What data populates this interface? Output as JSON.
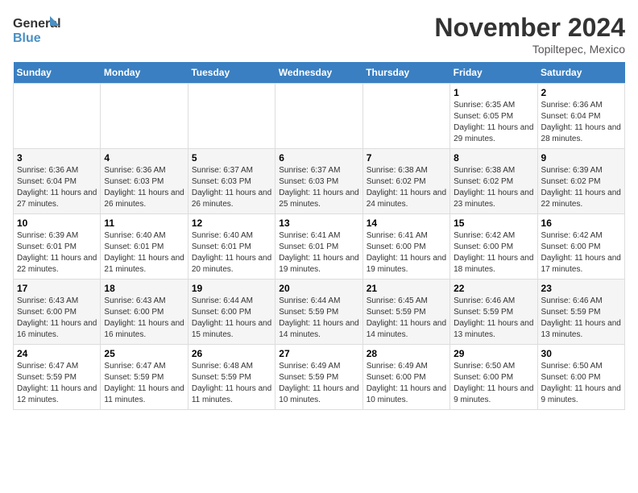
{
  "header": {
    "logo_line1": "General",
    "logo_line2": "Blue",
    "month": "November 2024",
    "location": "Topiltepec, Mexico"
  },
  "weekdays": [
    "Sunday",
    "Monday",
    "Tuesday",
    "Wednesday",
    "Thursday",
    "Friday",
    "Saturday"
  ],
  "weeks": [
    [
      {
        "day": "",
        "info": ""
      },
      {
        "day": "",
        "info": ""
      },
      {
        "day": "",
        "info": ""
      },
      {
        "day": "",
        "info": ""
      },
      {
        "day": "",
        "info": ""
      },
      {
        "day": "1",
        "info": "Sunrise: 6:35 AM\nSunset: 6:05 PM\nDaylight: 11 hours and 29 minutes."
      },
      {
        "day": "2",
        "info": "Sunrise: 6:36 AM\nSunset: 6:04 PM\nDaylight: 11 hours and 28 minutes."
      }
    ],
    [
      {
        "day": "3",
        "info": "Sunrise: 6:36 AM\nSunset: 6:04 PM\nDaylight: 11 hours and 27 minutes."
      },
      {
        "day": "4",
        "info": "Sunrise: 6:36 AM\nSunset: 6:03 PM\nDaylight: 11 hours and 26 minutes."
      },
      {
        "day": "5",
        "info": "Sunrise: 6:37 AM\nSunset: 6:03 PM\nDaylight: 11 hours and 26 minutes."
      },
      {
        "day": "6",
        "info": "Sunrise: 6:37 AM\nSunset: 6:03 PM\nDaylight: 11 hours and 25 minutes."
      },
      {
        "day": "7",
        "info": "Sunrise: 6:38 AM\nSunset: 6:02 PM\nDaylight: 11 hours and 24 minutes."
      },
      {
        "day": "8",
        "info": "Sunrise: 6:38 AM\nSunset: 6:02 PM\nDaylight: 11 hours and 23 minutes."
      },
      {
        "day": "9",
        "info": "Sunrise: 6:39 AM\nSunset: 6:02 PM\nDaylight: 11 hours and 22 minutes."
      }
    ],
    [
      {
        "day": "10",
        "info": "Sunrise: 6:39 AM\nSunset: 6:01 PM\nDaylight: 11 hours and 22 minutes."
      },
      {
        "day": "11",
        "info": "Sunrise: 6:40 AM\nSunset: 6:01 PM\nDaylight: 11 hours and 21 minutes."
      },
      {
        "day": "12",
        "info": "Sunrise: 6:40 AM\nSunset: 6:01 PM\nDaylight: 11 hours and 20 minutes."
      },
      {
        "day": "13",
        "info": "Sunrise: 6:41 AM\nSunset: 6:01 PM\nDaylight: 11 hours and 19 minutes."
      },
      {
        "day": "14",
        "info": "Sunrise: 6:41 AM\nSunset: 6:00 PM\nDaylight: 11 hours and 19 minutes."
      },
      {
        "day": "15",
        "info": "Sunrise: 6:42 AM\nSunset: 6:00 PM\nDaylight: 11 hours and 18 minutes."
      },
      {
        "day": "16",
        "info": "Sunrise: 6:42 AM\nSunset: 6:00 PM\nDaylight: 11 hours and 17 minutes."
      }
    ],
    [
      {
        "day": "17",
        "info": "Sunrise: 6:43 AM\nSunset: 6:00 PM\nDaylight: 11 hours and 16 minutes."
      },
      {
        "day": "18",
        "info": "Sunrise: 6:43 AM\nSunset: 6:00 PM\nDaylight: 11 hours and 16 minutes."
      },
      {
        "day": "19",
        "info": "Sunrise: 6:44 AM\nSunset: 6:00 PM\nDaylight: 11 hours and 15 minutes."
      },
      {
        "day": "20",
        "info": "Sunrise: 6:44 AM\nSunset: 5:59 PM\nDaylight: 11 hours and 14 minutes."
      },
      {
        "day": "21",
        "info": "Sunrise: 6:45 AM\nSunset: 5:59 PM\nDaylight: 11 hours and 14 minutes."
      },
      {
        "day": "22",
        "info": "Sunrise: 6:46 AM\nSunset: 5:59 PM\nDaylight: 11 hours and 13 minutes."
      },
      {
        "day": "23",
        "info": "Sunrise: 6:46 AM\nSunset: 5:59 PM\nDaylight: 11 hours and 13 minutes."
      }
    ],
    [
      {
        "day": "24",
        "info": "Sunrise: 6:47 AM\nSunset: 5:59 PM\nDaylight: 11 hours and 12 minutes."
      },
      {
        "day": "25",
        "info": "Sunrise: 6:47 AM\nSunset: 5:59 PM\nDaylight: 11 hours and 11 minutes."
      },
      {
        "day": "26",
        "info": "Sunrise: 6:48 AM\nSunset: 5:59 PM\nDaylight: 11 hours and 11 minutes."
      },
      {
        "day": "27",
        "info": "Sunrise: 6:49 AM\nSunset: 5:59 PM\nDaylight: 11 hours and 10 minutes."
      },
      {
        "day": "28",
        "info": "Sunrise: 6:49 AM\nSunset: 6:00 PM\nDaylight: 11 hours and 10 minutes."
      },
      {
        "day": "29",
        "info": "Sunrise: 6:50 AM\nSunset: 6:00 PM\nDaylight: 11 hours and 9 minutes."
      },
      {
        "day": "30",
        "info": "Sunrise: 6:50 AM\nSunset: 6:00 PM\nDaylight: 11 hours and 9 minutes."
      }
    ]
  ]
}
